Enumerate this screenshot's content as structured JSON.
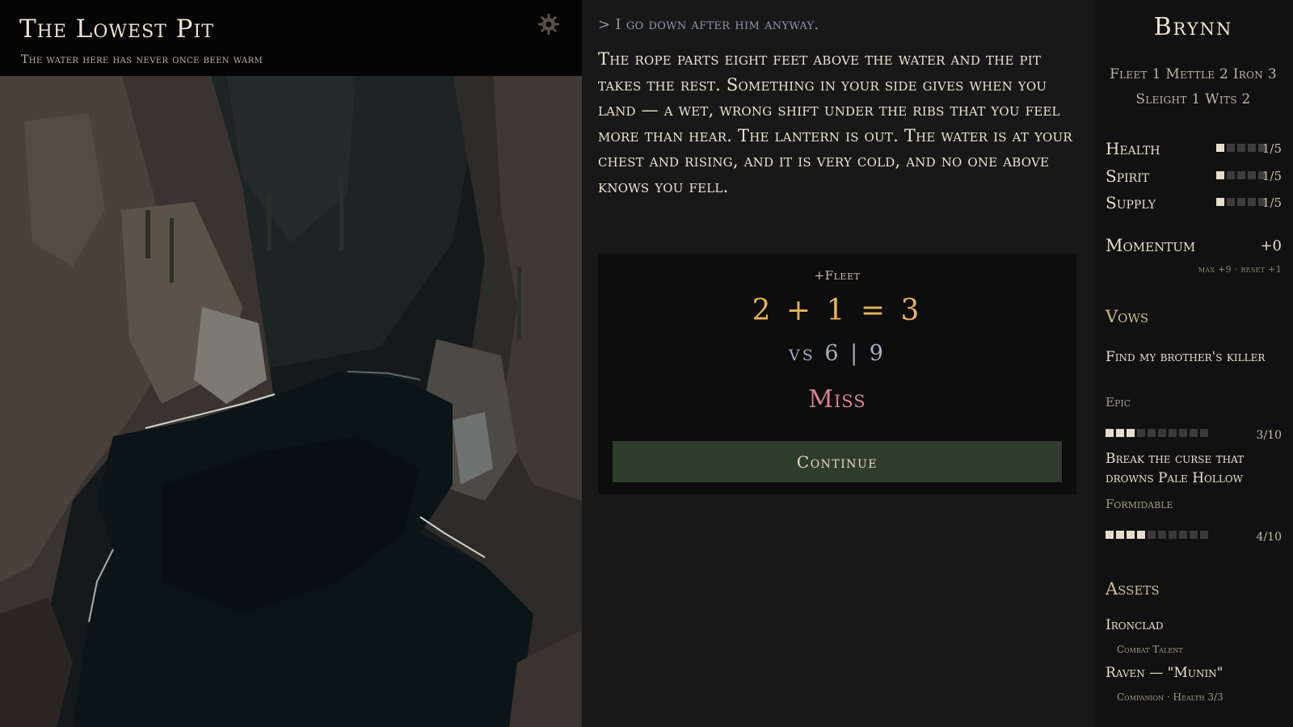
{
  "scene": {
    "title": "The Lowest Pit",
    "subtitle": "The water here has never once been warm",
    "settings_icon": "gear-icon"
  },
  "story": {
    "action_echo": "> I go down after him anyway.",
    "narrative": "The rope parts eight feet above the water and the pit takes the rest. Something in your side gives when you land — a wet, wrong shift under the ribs that you feel more than hear. The lantern is out. The water is at your chest and rising, and it is very cold, and no one above knows you fell.",
    "roll": {
      "stat": "+Fleet",
      "sum": "2 + 1 = 3",
      "vs": "vs 6 | 9",
      "outcome": "Miss"
    },
    "continue_label": "Continue"
  },
  "character": {
    "name": "Brynn",
    "stats_line1": "Fleet 1  Mettle 2  Iron 3",
    "stats_line2": "Sleight 1  Wits 2",
    "meters": [
      {
        "label": "Health",
        "value": 1,
        "max": 5,
        "text": "1/5"
      },
      {
        "label": "Spirit",
        "value": 1,
        "max": 5,
        "text": "1/5"
      },
      {
        "label": "Supply",
        "value": 1,
        "max": 5,
        "text": "1/5"
      }
    ],
    "momentum": {
      "label": "Momentum",
      "value": "+0",
      "sub": "max +9  ·  reset +1"
    },
    "vows_heading": "Vows",
    "vows": [
      {
        "title": "Find my brother's killer",
        "rank": "Epic",
        "progress": 3,
        "max": 10,
        "text": "3/10"
      },
      {
        "title": "Break the curse that drowns Pale Hollow",
        "rank": "Formidable",
        "progress": 4,
        "max": 10,
        "text": "4/10"
      }
    ],
    "assets_heading": "Assets",
    "assets": [
      {
        "name": "Ironclad",
        "sub": "Combat Talent"
      },
      {
        "name": "Raven — \"Munin\"",
        "sub": "Companion · Health 3/3"
      }
    ]
  },
  "colors": {
    "background": "#161616",
    "sum": "#e8b25f",
    "miss": "#d8838b",
    "continue_bg": "#2e3d2c",
    "vs": "#a5aec1",
    "section_head": "#cdbf97"
  }
}
